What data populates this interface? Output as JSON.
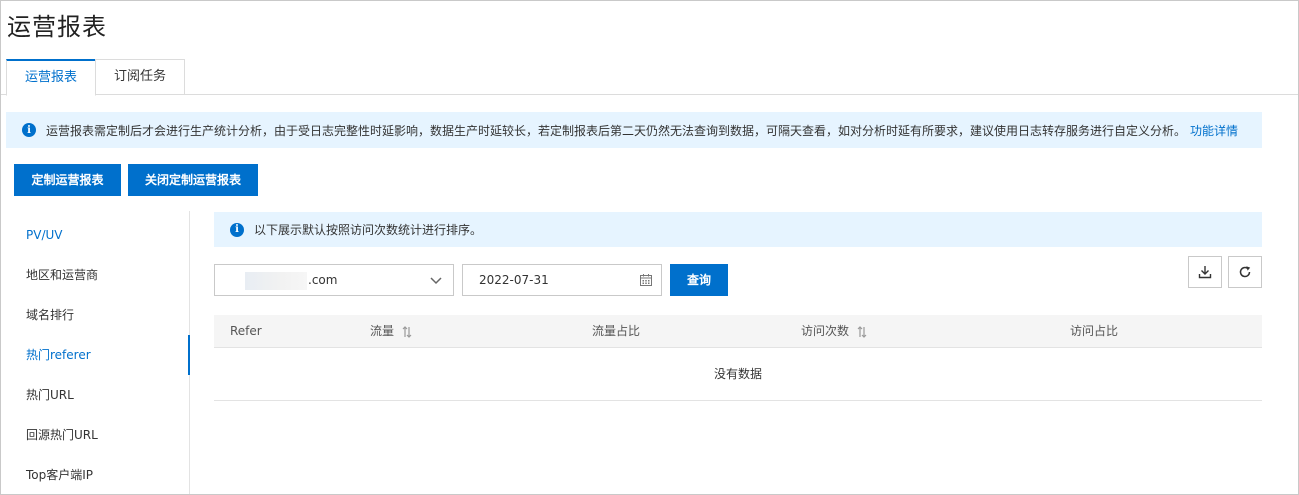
{
  "page": {
    "title": "运营报表"
  },
  "tabs": [
    {
      "label": "运营报表",
      "active": true
    },
    {
      "label": "订阅任务",
      "active": false
    }
  ],
  "notice": {
    "text": "运营报表需定制后才会进行生产统计分析，由于受日志完整性时延影响，数据生产时延较长，若定制报表后第二天仍然无法查询到数据，可隔天查看，如对分析时延有所要求，建议使用日志转存服务进行自定义分析。",
    "link": "功能详情"
  },
  "actions": {
    "custom": "定制运营报表",
    "close": "关闭定制运营报表"
  },
  "sidebar": {
    "items": [
      {
        "label": "PV/UV"
      },
      {
        "label": "地区和运营商"
      },
      {
        "label": "域名排行"
      },
      {
        "label": "热门referer",
        "active": true
      },
      {
        "label": "热门URL"
      },
      {
        "label": "回源热门URL"
      },
      {
        "label": "Top客户端IP"
      }
    ]
  },
  "subnotice": {
    "text": "以下展示默认按照访问次数统计进行排序。"
  },
  "filters": {
    "domain": ".com",
    "date": "2022-07-31",
    "query": "查询"
  },
  "table": {
    "columns": [
      "Refer",
      "流量",
      "流量占比",
      "访问次数",
      "访问占比"
    ],
    "empty": "没有数据"
  },
  "colors": {
    "primary": "#0070cc",
    "info_bg": "#e6f4ff",
    "border": "#c9c9c9"
  },
  "icons": {
    "info": "info-icon",
    "download": "download-icon",
    "refresh": "refresh-icon",
    "calendar": "calendar-icon",
    "chevron": "chevron-down-icon",
    "sort": "sort-icon"
  }
}
